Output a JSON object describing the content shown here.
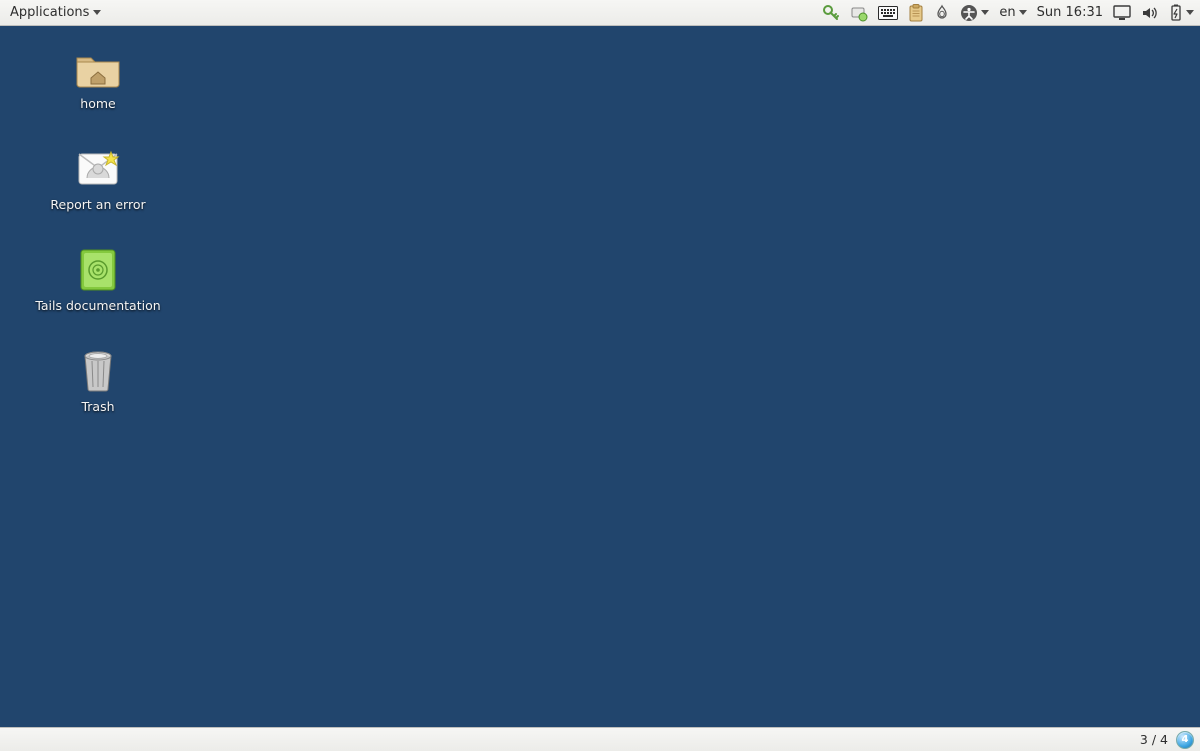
{
  "top_panel": {
    "apps_menu_label": "Applications",
    "language": "en",
    "clock": "Sun 16:31"
  },
  "desktop": {
    "icons": [
      {
        "label": "home"
      },
      {
        "label": "Report an error"
      },
      {
        "label": "Tails documentation"
      },
      {
        "label": "Trash"
      }
    ]
  },
  "bottom_panel": {
    "workspace": "3 / 4",
    "switcher_badge": "4"
  }
}
